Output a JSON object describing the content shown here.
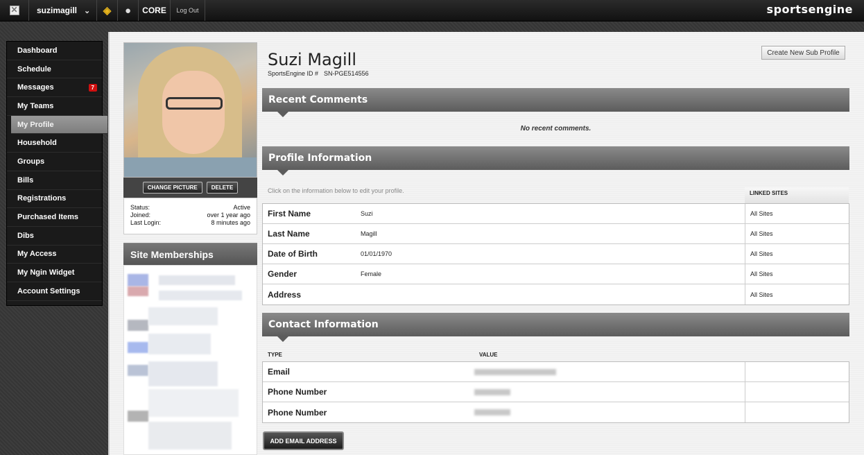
{
  "topbar": {
    "username": "suzimagill",
    "core_label": "CORE",
    "logout_label": "Log Out",
    "brand": "sportsengine"
  },
  "nav": {
    "items": [
      {
        "label": "Dashboard"
      },
      {
        "label": "Schedule"
      },
      {
        "label": "Messages",
        "badge": "7"
      },
      {
        "label": "My Teams"
      },
      {
        "label": "My Profile"
      },
      {
        "label": "Household"
      },
      {
        "label": "Groups"
      },
      {
        "label": "Bills"
      },
      {
        "label": "Registrations"
      },
      {
        "label": "Purchased Items"
      },
      {
        "label": "Dibs"
      },
      {
        "label": "My Access"
      },
      {
        "label": "My Ngin Widget"
      },
      {
        "label": "Account Settings"
      }
    ],
    "active_index": 4
  },
  "profile": {
    "name": "Suzi Magill",
    "id_label": "SportsEngine ID #",
    "id_value": "SN-PGE514556",
    "change_picture": "CHANGE PICTURE",
    "delete": "DELETE",
    "status_label": "Status:",
    "status_value": "Active",
    "joined_label": "Joined:",
    "joined_value": "over 1 year ago",
    "last_login_label": "Last Login:",
    "last_login_value": "8 minutes ago",
    "sub_profile_button": "Create New Sub Profile"
  },
  "site_memberships": {
    "title": "Site Memberships"
  },
  "recent_comments": {
    "title": "Recent Comments",
    "empty": "No recent comments."
  },
  "profile_info": {
    "title": "Profile Information",
    "hint": "Click on the information below to edit your profile.",
    "linked_header": "LINKED SITES",
    "rows": [
      {
        "label": "First Name",
        "value": "Suzi",
        "linked": "All Sites"
      },
      {
        "label": "Last Name",
        "value": "Magill",
        "linked": "All Sites"
      },
      {
        "label": "Date of Birth",
        "value": "01/01/1970",
        "linked": "All Sites"
      },
      {
        "label": "Gender",
        "value": "Female",
        "linked": "All Sites"
      },
      {
        "label": "Address",
        "value": "",
        "linked": "All Sites"
      }
    ]
  },
  "contact_info": {
    "title": "Contact Information",
    "type_header": "TYPE",
    "value_header": "VALUE",
    "rows": [
      {
        "label": "Email"
      },
      {
        "label": "Phone Number"
      },
      {
        "label": "Phone Number"
      }
    ],
    "add_email": "ADD EMAIL ADDRESS"
  }
}
